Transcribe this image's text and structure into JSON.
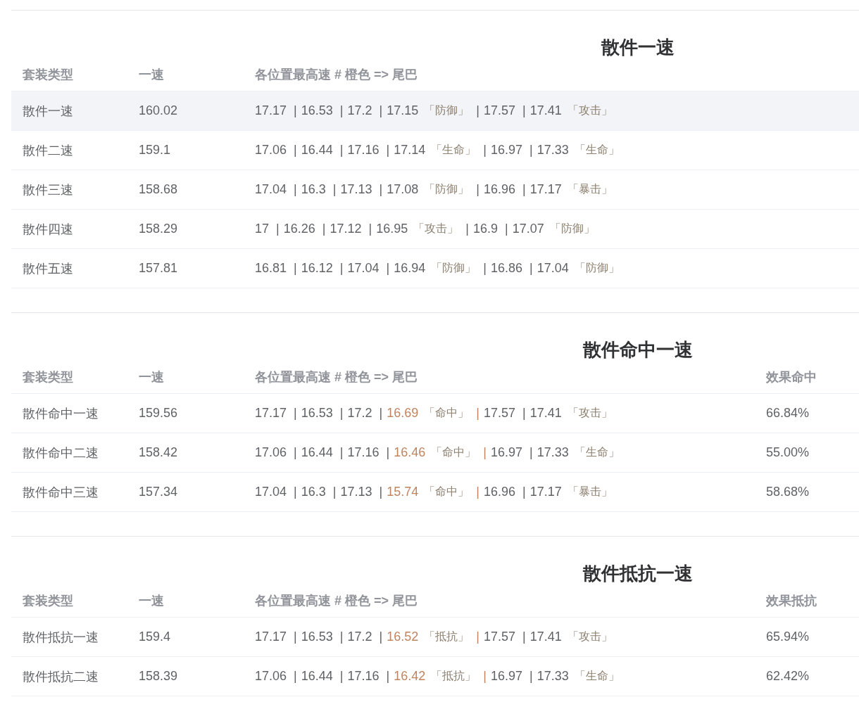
{
  "sections": [
    {
      "title": "散件一速",
      "separator": "|",
      "columns": [
        "套装类型",
        "一速",
        "各位置最高速 # 橙色 => 尾巴"
      ],
      "rows": [
        {
          "type": "散件一速",
          "speed": "160.02",
          "selected": true,
          "slots": [
            {
              "value": "17.17",
              "highlight": false
            },
            {
              "value": "16.53",
              "highlight": false
            },
            {
              "value": "17.2",
              "highlight": false
            },
            {
              "value": "17.15",
              "tag": "「防御」",
              "highlight": false
            },
            {
              "value": "17.57",
              "highlight": false
            },
            {
              "value": "17.41",
              "tag": "「攻击」",
              "highlight": false
            }
          ]
        },
        {
          "type": "散件二速",
          "speed": "159.1",
          "selected": false,
          "slots": [
            {
              "value": "17.06",
              "highlight": false
            },
            {
              "value": "16.44",
              "highlight": false
            },
            {
              "value": "17.16",
              "highlight": false
            },
            {
              "value": "17.14",
              "tag": "「生命」",
              "highlight": false
            },
            {
              "value": "16.97",
              "highlight": false
            },
            {
              "value": "17.33",
              "tag": "「生命」",
              "highlight": false
            }
          ]
        },
        {
          "type": "散件三速",
          "speed": "158.68",
          "selected": false,
          "slots": [
            {
              "value": "17.04",
              "highlight": false
            },
            {
              "value": "16.3",
              "highlight": false
            },
            {
              "value": "17.13",
              "highlight": false
            },
            {
              "value": "17.08",
              "tag": "「防御」",
              "highlight": false
            },
            {
              "value": "16.96",
              "highlight": false
            },
            {
              "value": "17.17",
              "tag": "「暴击」",
              "highlight": false
            }
          ]
        },
        {
          "type": "散件四速",
          "speed": "158.29",
          "selected": false,
          "slots": [
            {
              "value": "17",
              "highlight": false
            },
            {
              "value": "16.26",
              "highlight": false
            },
            {
              "value": "17.12",
              "highlight": false
            },
            {
              "value": "16.95",
              "tag": "「攻击」",
              "highlight": false
            },
            {
              "value": "16.9",
              "highlight": false
            },
            {
              "value": "17.07",
              "tag": "「防御」",
              "highlight": false
            }
          ]
        },
        {
          "type": "散件五速",
          "speed": "157.81",
          "selected": false,
          "slots": [
            {
              "value": "16.81",
              "highlight": false
            },
            {
              "value": "16.12",
              "highlight": false
            },
            {
              "value": "17.04",
              "highlight": false
            },
            {
              "value": "16.94",
              "tag": "「防御」",
              "highlight": false
            },
            {
              "value": "16.86",
              "highlight": false
            },
            {
              "value": "17.04",
              "tag": "「防御」",
              "highlight": false
            }
          ]
        }
      ]
    },
    {
      "title": "散件命中一速",
      "separator": "|",
      "columns": [
        "套装类型",
        "一速",
        "各位置最高速 # 橙色 => 尾巴",
        "效果命中"
      ],
      "rows": [
        {
          "type": "散件命中一速",
          "speed": "159.56",
          "selected": false,
          "extra": "66.84%",
          "slots": [
            {
              "value": "17.17",
              "highlight": false
            },
            {
              "value": "16.53",
              "highlight": false
            },
            {
              "value": "17.2",
              "highlight": false
            },
            {
              "value": "16.69",
              "tag": "「命中」",
              "highlight": true
            },
            {
              "value": "17.57",
              "highlight": false
            },
            {
              "value": "17.41",
              "tag": "「攻击」",
              "highlight": false
            }
          ]
        },
        {
          "type": "散件命中二速",
          "speed": "158.42",
          "selected": false,
          "extra": "55.00%",
          "slots": [
            {
              "value": "17.06",
              "highlight": false
            },
            {
              "value": "16.44",
              "highlight": false
            },
            {
              "value": "17.16",
              "highlight": false
            },
            {
              "value": "16.46",
              "tag": "「命中」",
              "highlight": true
            },
            {
              "value": "16.97",
              "highlight": false
            },
            {
              "value": "17.33",
              "tag": "「生命」",
              "highlight": false
            }
          ]
        },
        {
          "type": "散件命中三速",
          "speed": "157.34",
          "selected": false,
          "extra": "58.68%",
          "slots": [
            {
              "value": "17.04",
              "highlight": false
            },
            {
              "value": "16.3",
              "highlight": false
            },
            {
              "value": "17.13",
              "highlight": false
            },
            {
              "value": "15.74",
              "tag": "「命中」",
              "highlight": true
            },
            {
              "value": "16.96",
              "highlight": false
            },
            {
              "value": "17.17",
              "tag": "「暴击」",
              "highlight": false
            }
          ]
        }
      ]
    },
    {
      "title": "散件抵抗一速",
      "separator": "|",
      "columns": [
        "套装类型",
        "一速",
        "各位置最高速 # 橙色 => 尾巴",
        "效果抵抗"
      ],
      "rows": [
        {
          "type": "散件抵抗一速",
          "speed": "159.4",
          "selected": false,
          "extra": "65.94%",
          "slots": [
            {
              "value": "17.17",
              "highlight": false
            },
            {
              "value": "16.53",
              "highlight": false
            },
            {
              "value": "17.2",
              "highlight": false
            },
            {
              "value": "16.52",
              "tag": "「抵抗」",
              "highlight": true
            },
            {
              "value": "17.57",
              "highlight": false
            },
            {
              "value": "17.41",
              "tag": "「攻击」",
              "highlight": false
            }
          ]
        },
        {
          "type": "散件抵抗二速",
          "speed": "158.39",
          "selected": false,
          "extra": "62.42%",
          "slots": [
            {
              "value": "17.06",
              "highlight": false
            },
            {
              "value": "16.44",
              "highlight": false
            },
            {
              "value": "17.16",
              "highlight": false
            },
            {
              "value": "16.42",
              "tag": "「抵抗」",
              "highlight": true
            },
            {
              "value": "16.97",
              "highlight": false
            },
            {
              "value": "17.33",
              "tag": "「生命」",
              "highlight": false
            }
          ]
        }
      ]
    }
  ]
}
